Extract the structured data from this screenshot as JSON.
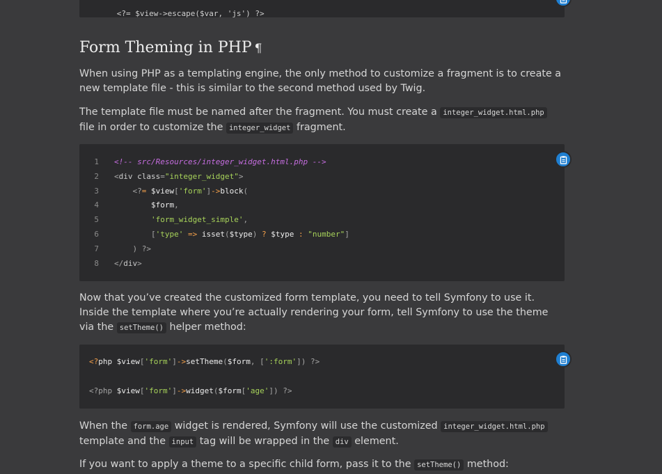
{
  "top_code": {
    "text": "<?= $view->escape($var, 'js') ?>"
  },
  "section": {
    "title": "Form Theming in PHP",
    "pilcrow": "¶"
  },
  "p1": "When using PHP as a templating engine, the only method to customize a fragment is to create a new template file - this is similar to the second method used by Twig.",
  "p2": {
    "before": "The template file must be named after the fragment. You must create a ",
    "code1": "integer_widget.html.php",
    "middle": " file in order to customize the ",
    "code2": "integer_widget",
    "after": " fragment."
  },
  "code1": {
    "line_numbers": [
      "1",
      "2",
      "3",
      "4",
      "5",
      "6",
      "7",
      "8"
    ],
    "lines": [
      "<!-- src/Resources/integer_widget.html.php -->",
      "<div class=\"integer_widget\">",
      "    <?= $view['form']->block(",
      "        $form,",
      "        'form_widget_simple',",
      "        ['type' => isset($type) ? $type : \"number\"]",
      "    ) ?>",
      "</div>"
    ]
  },
  "p3": {
    "before": "Now that you’ve created the customized form template, you need to tell Symfony to use it. Inside the template where you’re actually rendering your form, tell Symfony to use the theme via the ",
    "code": "setTheme()",
    "after": " helper method:"
  },
  "code2": {
    "lines": [
      "<?php $view['form']->setTheme($form, [':form']) ?>",
      "<?php $view['form']->widget($form['age']) ?>"
    ]
  },
  "p4": {
    "t1": "When the ",
    "c1": "form.age",
    "t2": " widget is rendered, Symfony will use the customized ",
    "c2": "integer_widget.html.php",
    "t3": " template and the ",
    "c3": "input",
    "t4": " tag will be wrapped in the ",
    "c4": "div",
    "t5": " element."
  },
  "p5": {
    "before": "If you want to apply a theme to a specific child form, pass it to the ",
    "code": "setTheme()",
    "after": " method:"
  },
  "icons": {
    "copy": "clipboard-icon"
  },
  "colors": {
    "background": "#3a3a3c",
    "code_bg": "#2a2a2c",
    "copy_button": "#1f7fd1"
  }
}
